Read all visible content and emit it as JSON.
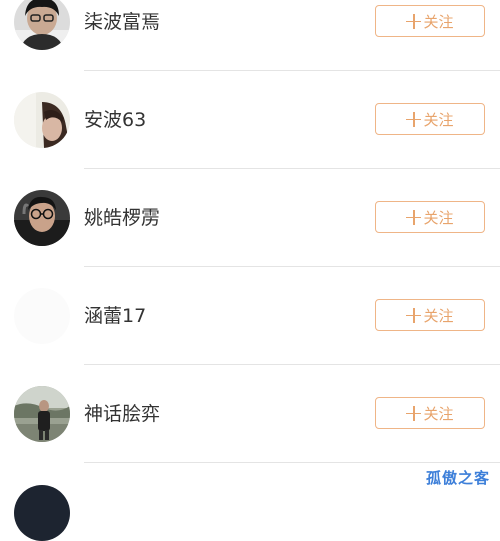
{
  "users": [
    {
      "name": "柒波富焉",
      "avatar": "avatar-photo-dark-hair",
      "follow_label": "关注"
    },
    {
      "name": "安波63",
      "avatar": "avatar-photo-pale",
      "follow_label": "关注"
    },
    {
      "name": "姚皓椤雳",
      "avatar": "avatar-photo-glasses",
      "follow_label": "关注"
    },
    {
      "name": "涵蕾17",
      "avatar": "avatar-blank",
      "follow_label": "关注"
    },
    {
      "name": "神话脍弈",
      "avatar": "avatar-photo-outdoor",
      "follow_label": "关注"
    }
  ],
  "watermark": "孤傲之客",
  "colors": {
    "accent": "#e8a46c",
    "accent_border": "#efb587",
    "text": "#333333",
    "divider": "#e4e4e4",
    "watermark": "#3d7fd9"
  }
}
